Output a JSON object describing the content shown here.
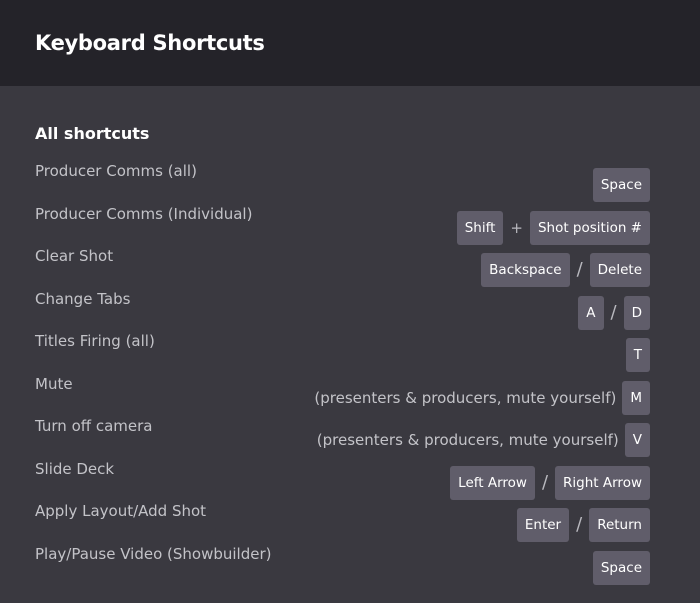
{
  "header": {
    "title": "Keyboard Shortcuts"
  },
  "section": {
    "title": "All shortcuts"
  },
  "shortcuts": [
    {
      "label": "Producer Comms (all)",
      "keys": [
        "Space"
      ]
    },
    {
      "label": "Producer Comms (Individual)",
      "keys": [
        "Shift",
        "Shot position #"
      ],
      "separator": "+"
    },
    {
      "label": "Clear Shot",
      "keys": [
        "Backspace",
        "Delete"
      ],
      "separator": "/"
    },
    {
      "label": "Change Tabs",
      "keys": [
        "A",
        "D"
      ],
      "separator": "/"
    },
    {
      "label": "Titles Firing (all)",
      "keys": [
        "T"
      ]
    },
    {
      "label": "Mute",
      "note": "(presenters & producers, mute yourself)",
      "keys": [
        "M"
      ]
    },
    {
      "label": "Turn off camera",
      "note": "(presenters & producers, mute yourself)",
      "keys": [
        "V"
      ]
    },
    {
      "label": "Slide Deck",
      "keys": [
        "Left Arrow",
        "Right Arrow"
      ],
      "separator": "/"
    },
    {
      "label": "Apply Layout/Add Shot",
      "keys": [
        "Enter",
        "Return"
      ],
      "separator": "/"
    },
    {
      "label": "Play/Pause Video (Showbuilder)",
      "keys": [
        "Space"
      ]
    }
  ]
}
